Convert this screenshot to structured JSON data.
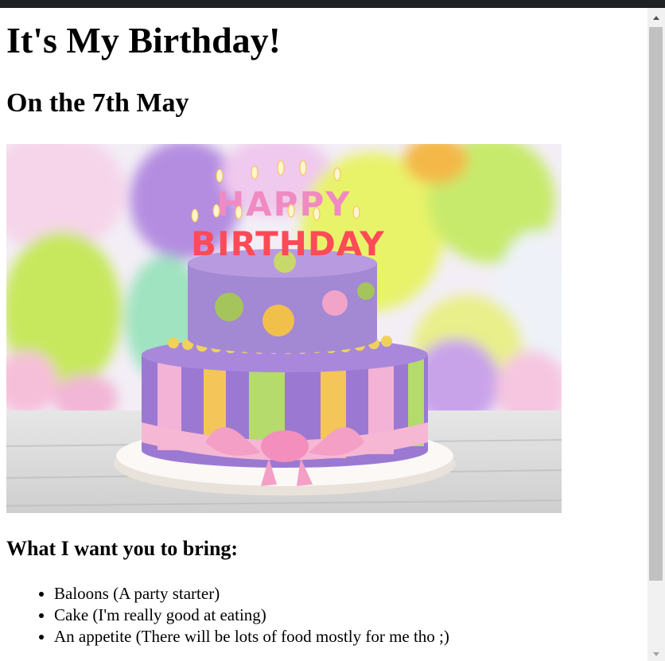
{
  "page": {
    "title": "It's My Birthday!",
    "subtitle": "On the 7th May",
    "image": {
      "topper_line1": "HAPPY",
      "topper_line2": "BIRTHDAY"
    },
    "list_heading": "What I want you to bring:",
    "list_items": [
      "Baloons (A party starter)",
      "Cake (I'm really good at eating)",
      "An appetite (There will be lots of food mostly for me tho ;)"
    ]
  },
  "colors": {
    "top_bar": "#202124",
    "scrollbar_track": "#f1f1f1",
    "scrollbar_thumb": "#c1c1c1"
  }
}
